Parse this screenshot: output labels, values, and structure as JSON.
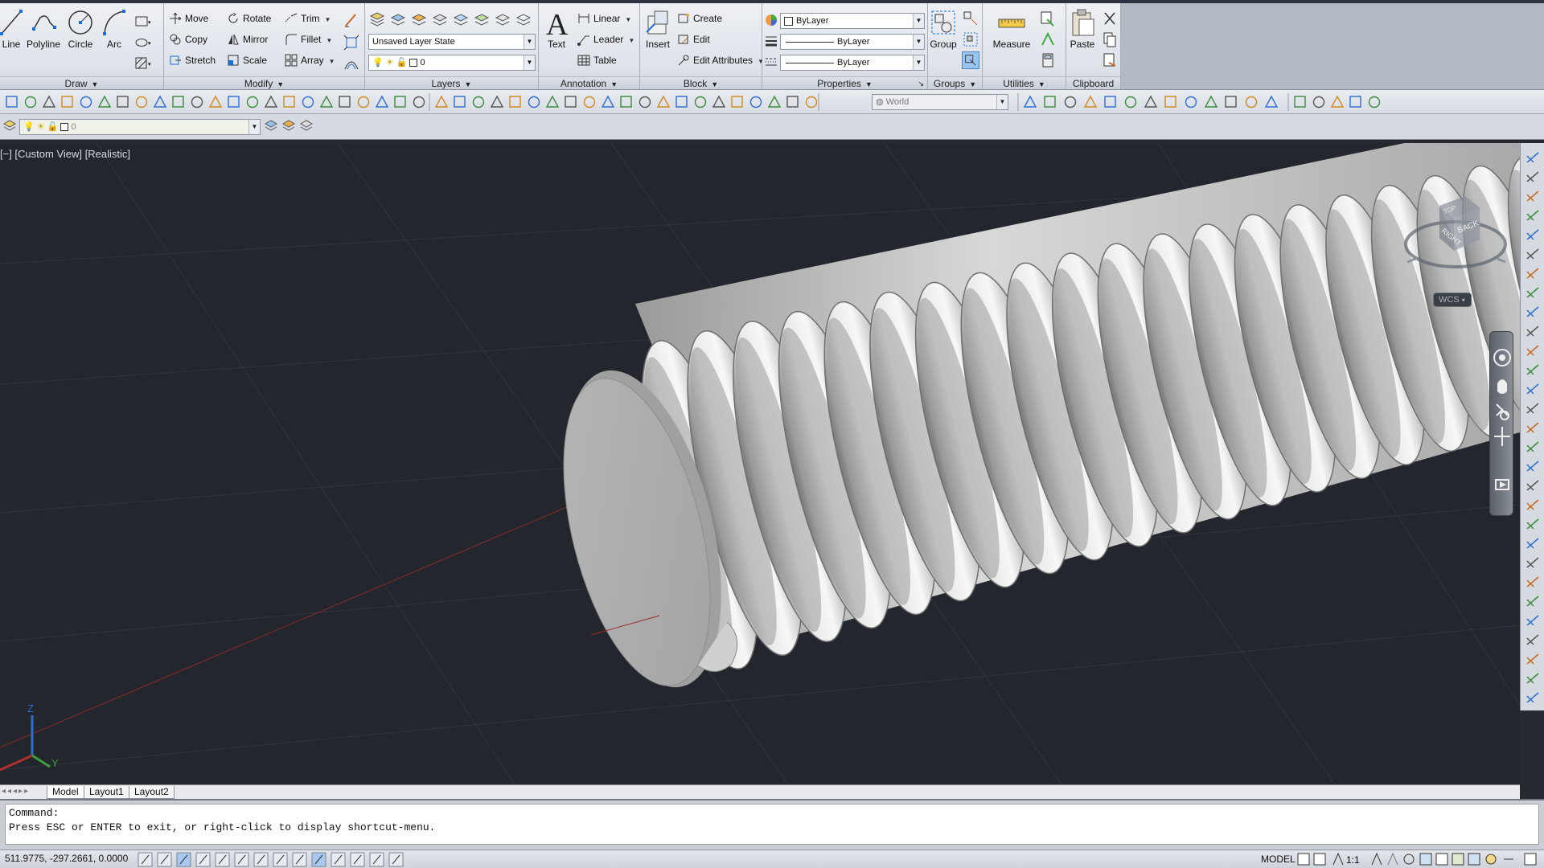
{
  "ribbon": {
    "draw": {
      "title": "Draw",
      "line": "Line",
      "polyline": "Polyline",
      "circle": "Circle",
      "arc": "Arc"
    },
    "modify": {
      "title": "Modify",
      "move": "Move",
      "rotate": "Rotate",
      "trim": "Trim",
      "copy": "Copy",
      "mirror": "Mirror",
      "fillet": "Fillet",
      "stretch": "Stretch",
      "scale": "Scale",
      "array": "Array"
    },
    "layers": {
      "title": "Layers",
      "layer_state": "Unsaved Layer State",
      "current_layer": "0"
    },
    "annotation": {
      "title": "Annotation",
      "text": "Text",
      "linear": "Linear",
      "leader": "Leader",
      "table": "Table"
    },
    "block": {
      "title": "Block",
      "insert": "Insert",
      "create": "Create",
      "edit": "Edit",
      "edit_attributes": "Edit Attributes"
    },
    "properties": {
      "title": "Properties",
      "color": "ByLayer",
      "linetype": "ByLayer",
      "lineweight": "ByLayer"
    },
    "groups": {
      "title": "Groups",
      "group": "Group"
    },
    "utilities": {
      "title": "Utilities",
      "measure": "Measure"
    },
    "clipboard": {
      "title": "Clipboard",
      "paste": "Paste"
    }
  },
  "toolbar": {
    "ucs_combo": "World",
    "layer_combo": "0"
  },
  "viewport": {
    "label": "[−] [Custom View] [Realistic]",
    "viewcube_right": "RIGHT",
    "viewcube_back": "BACK",
    "viewcube_top": "TOP",
    "wcs": "WCS",
    "axis_z": "Z",
    "axis_y": "Y"
  },
  "tabs": {
    "model": "Model",
    "layout1": "Layout1",
    "layout2": "Layout2"
  },
  "command": {
    "line1": "Command:",
    "line2": "Press ESC or ENTER to exit, or right-click to display shortcut-menu."
  },
  "status": {
    "coordinates": "511.9775,  -297.2661, 0.0000",
    "model": "MODEL",
    "annotation_scale": "1:1"
  },
  "colors": {
    "viewport_bg": "#23262c",
    "ribbon_bg": "#dfe3ea",
    "bolt": "#c8c8c8"
  }
}
